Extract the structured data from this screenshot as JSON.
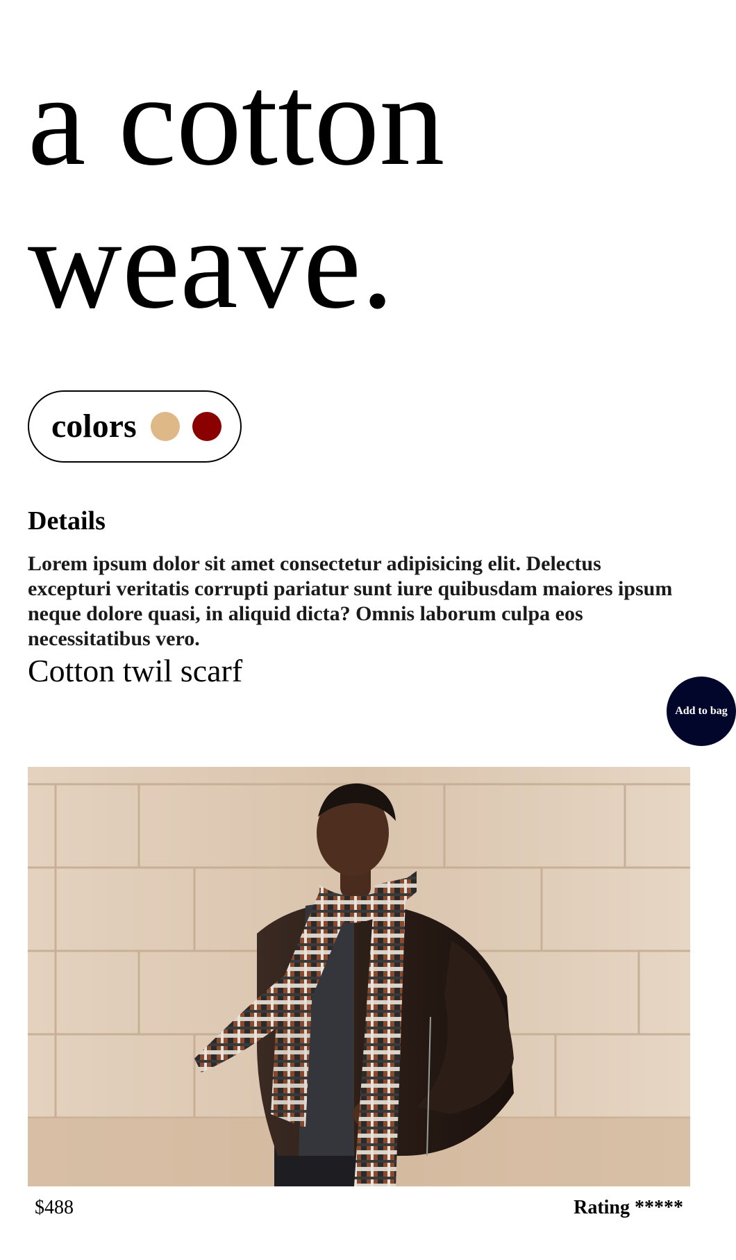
{
  "hero": {
    "title": "a cotton weave."
  },
  "colors": {
    "label": "colors",
    "swatches": [
      {
        "name": "tan",
        "color": "#deb887"
      },
      {
        "name": "dark-red",
        "color": "#8b0000"
      }
    ]
  },
  "details": {
    "heading": "Details",
    "text": "Lorem ipsum dolor sit amet consectetur adipisicing elit. Delectus excepturi veritatis corrupti pariatur sunt iure quibusdam maiores ipsum neque dolore quasi, in aliquid dicta? Omnis laborum culpa eos necessitatibus vero."
  },
  "product": {
    "name": "Cotton twil scarf",
    "add_to_bag_label": "Add to bag",
    "price": "$488",
    "rating": "Rating *****",
    "image_subject": "model-wearing-plaid-scarf-photo"
  },
  "theme": {
    "button_bg": "#03062b",
    "text": "#000000"
  }
}
